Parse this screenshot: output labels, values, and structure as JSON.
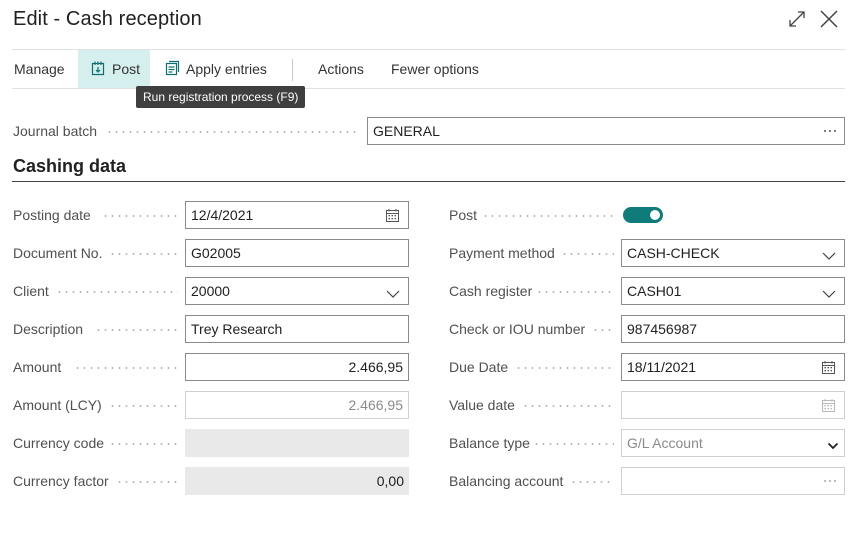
{
  "window": {
    "title": "Edit - Cash reception",
    "expand_icon": "expand-icon",
    "close_icon": "close-icon"
  },
  "toolbar": {
    "manage": "Manage",
    "post": "Post",
    "apply_entries": "Apply entries",
    "actions": "Actions",
    "fewer_options": "Fewer options",
    "post_tooltip": "Run registration process (F9)"
  },
  "journal_batch": {
    "label": "Journal batch",
    "value": "GENERAL"
  },
  "section": {
    "title": "Cashing data"
  },
  "fields_left": {
    "posting_date": {
      "label": "Posting date",
      "value": "12/4/2021"
    },
    "document_no": {
      "label": "Document No.",
      "value": "G02005"
    },
    "client": {
      "label": "Client",
      "value": "20000"
    },
    "description": {
      "label": "Description",
      "value": "Trey Research"
    },
    "amount": {
      "label": "Amount",
      "value": "2.466,95"
    },
    "amount_lcy": {
      "label": "Amount (LCY)",
      "value": "2.466,95"
    },
    "currency_code": {
      "label": "Currency code",
      "value": ""
    },
    "currency_factor": {
      "label": "Currency factor",
      "value": "0,00"
    }
  },
  "fields_right": {
    "post": {
      "label": "Post",
      "enabled": true
    },
    "payment_method": {
      "label": "Payment method",
      "value": "CASH-CHECK"
    },
    "cash_register": {
      "label": "Cash register",
      "value": "CASH01"
    },
    "check_iou": {
      "label": "Check or IOU number",
      "value": "987456987"
    },
    "due_date": {
      "label": "Due Date",
      "value": "18/11/2021"
    },
    "value_date": {
      "label": "Value date",
      "value": ""
    },
    "balance_type": {
      "label": "Balance type",
      "value": "G/L Account"
    },
    "balancing_account": {
      "label": "Balancing account",
      "value": ""
    }
  },
  "colors": {
    "accent": "#0f7b7b",
    "post_highlight": "#d5eeee",
    "tooltip_bg": "#3f3f3f"
  }
}
